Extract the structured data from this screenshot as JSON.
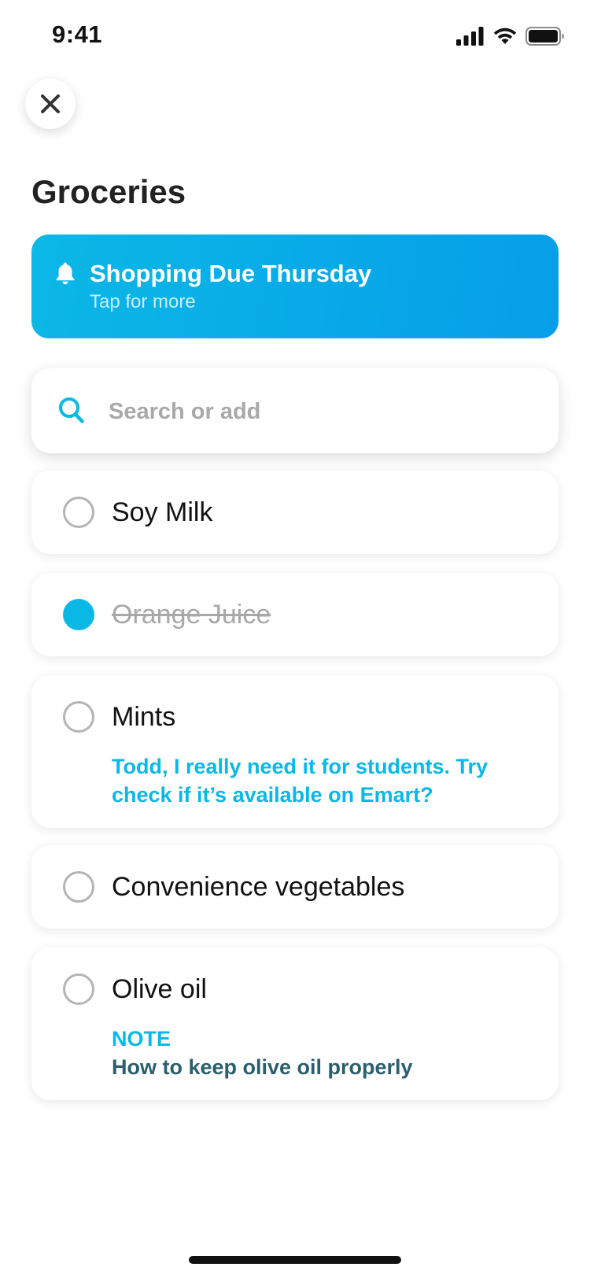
{
  "status_bar": {
    "time": "9:41",
    "icons": [
      "cellular-signal-icon",
      "wifi-icon",
      "battery-icon"
    ]
  },
  "header": {
    "close_icon": "close-icon",
    "title": "Groceries"
  },
  "banner": {
    "icon": "bell-icon",
    "title": "Shopping Due Thursday",
    "subtitle": "Tap for more",
    "gradient": [
      "#0bb8e6",
      "#069ee8"
    ]
  },
  "search": {
    "icon": "search-icon",
    "placeholder": "Search or add",
    "value": ""
  },
  "items": [
    {
      "label": "Soy Milk",
      "checked": false
    },
    {
      "label": "Orange Juice",
      "checked": true
    },
    {
      "label": "Mints",
      "checked": false,
      "note": "Todd, I really need it for students. Try check if it’s available on Emart?"
    },
    {
      "label": "Convenience vegetables",
      "checked": false
    },
    {
      "label": "Olive oil",
      "checked": false,
      "note_heading": "NOTE",
      "note_body": "How to keep olive oil properly"
    }
  ],
  "colors": {
    "accent": "#0ab8e6",
    "note_body": "#2b5f6e",
    "checked_text": "#a8a8a8"
  }
}
